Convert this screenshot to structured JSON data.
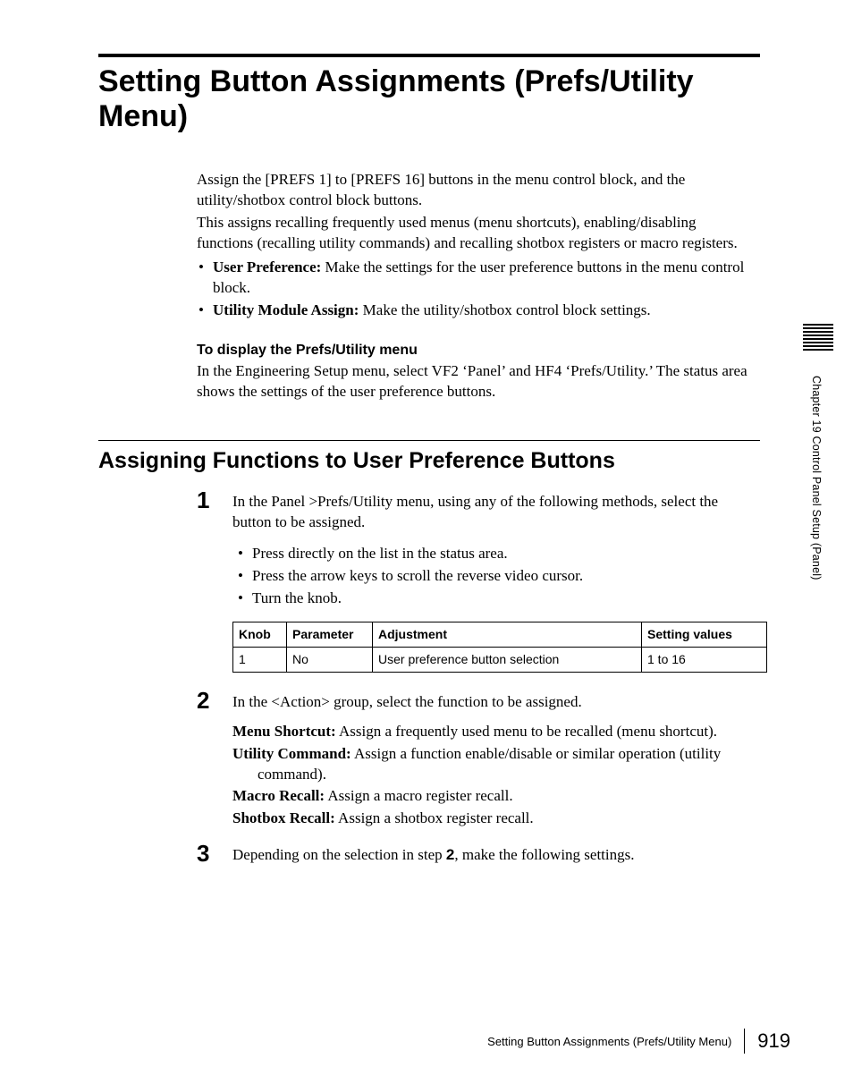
{
  "title": "Setting Button Assignments (Prefs/Utility Menu)",
  "intro": {
    "p1": "Assign the [PREFS 1] to [PREFS 16] buttons in the menu control block, and the utility/shotbox control block buttons.",
    "p2": "This assigns recalling frequently used menus (menu shortcuts), enabling/disabling functions (recalling utility commands) and recalling shotbox registers or macro registers.",
    "bullets": [
      {
        "label": "User Preference:",
        "text": " Make the settings for the user preference buttons in the menu control block."
      },
      {
        "label": "Utility Module Assign:",
        "text": " Make the utility/shotbox control block settings."
      }
    ],
    "subhead": "To display the Prefs/Utility menu",
    "p3": "In the Engineering Setup menu, select VF2 ‘Panel’ and HF4 ‘Prefs/Utility.’ The status area shows the settings of the user preference buttons."
  },
  "section2_title": "Assigning Functions to User Preference Buttons",
  "steps": {
    "s1": {
      "num": "1",
      "text": "In the Panel >Prefs/Utility menu, using any of the following methods, select the button to be assigned.",
      "bullets": [
        "Press directly on the list in the status area.",
        "Press the arrow keys to scroll the reverse video cursor.",
        "Turn the knob."
      ]
    },
    "s2": {
      "num": "2",
      "text": "In the <Action> group, select the function to be assigned.",
      "defs": [
        {
          "label": "Menu Shortcut:",
          "text": " Assign a frequently used menu to be recalled (menu shortcut)."
        },
        {
          "label": "Utility Command:",
          "text": " Assign a function enable/disable or similar operation (utility command)."
        },
        {
          "label": "Macro Recall:",
          "text": " Assign a macro register recall."
        },
        {
          "label": "Shotbox Recall:",
          "text": " Assign a shotbox register recall."
        }
      ]
    },
    "s3": {
      "num": "3",
      "text_before": "Depending on the selection in step ",
      "ref": "2",
      "text_after": ", make the following settings."
    }
  },
  "table": {
    "headers": [
      "Knob",
      "Parameter",
      "Adjustment",
      "Setting values"
    ],
    "rows": [
      [
        "1",
        "No",
        "User preference button selection",
        "1 to 16"
      ]
    ]
  },
  "side_label": "Chapter 19   Control Panel Setup (Panel)",
  "footer_title": "Setting Button Assignments (Prefs/Utility Menu)",
  "page_number": "919"
}
